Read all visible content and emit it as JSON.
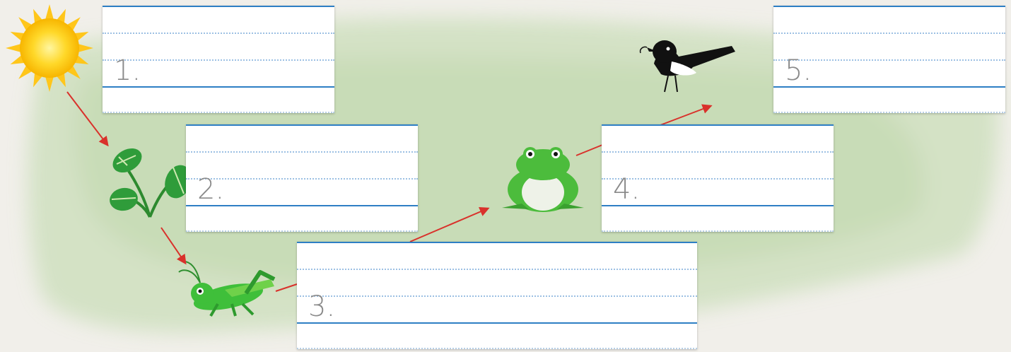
{
  "food_chain": {
    "boxes": [
      {
        "label": "1."
      },
      {
        "label": "2."
      },
      {
        "label": "3."
      },
      {
        "label": "4."
      },
      {
        "label": "5."
      }
    ],
    "organisms": [
      {
        "name": "sun",
        "icon": "sun-icon"
      },
      {
        "name": "plant",
        "icon": "plant-icon"
      },
      {
        "name": "grasshopper",
        "icon": "grasshopper-icon"
      },
      {
        "name": "frog",
        "icon": "frog-icon"
      },
      {
        "name": "bird",
        "icon": "willie-wagtail-icon"
      }
    ],
    "colors": {
      "arrow": "#d9312b",
      "line_blue": "#2e7fc4",
      "dots": "#9cc0e3",
      "wash": "#c7dcb6",
      "number": "#8a8a8a"
    }
  }
}
